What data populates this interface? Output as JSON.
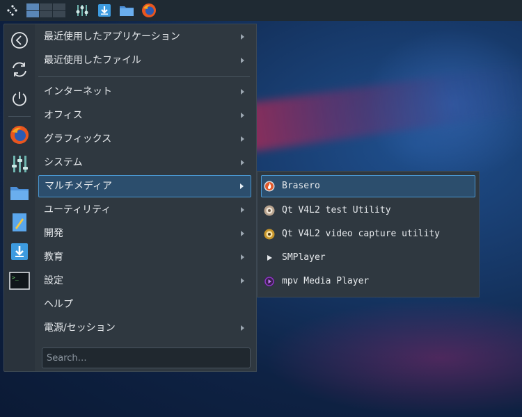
{
  "panel": {
    "icons": [
      "app-launcher-icon",
      "pager",
      "mixer-icon",
      "downloader-icon",
      "file-manager-icon",
      "firefox-icon"
    ]
  },
  "sidebar": {
    "icons": [
      "back-icon",
      "refresh-icon",
      "power-icon",
      "firefox-icon",
      "mixer-icon",
      "file-manager-icon",
      "text-editor-icon",
      "downloader-icon",
      "terminal-icon"
    ]
  },
  "menu": {
    "items": [
      {
        "label": "最近使用したアプリケーション"
      },
      {
        "label": "最近使用したファイル"
      },
      {
        "label": "インターネット"
      },
      {
        "label": "オフィス"
      },
      {
        "label": "グラフィックス"
      },
      {
        "label": "システム"
      },
      {
        "label": "マルチメディア"
      },
      {
        "label": "ユーティリティ"
      },
      {
        "label": "開発"
      },
      {
        "label": "教育"
      },
      {
        "label": "設定"
      },
      {
        "label": "ヘルプ"
      },
      {
        "label": "電源/セッション"
      }
    ],
    "selected": "マルチメディア"
  },
  "search": {
    "placeholder": "Search…"
  },
  "submenu": {
    "items": [
      {
        "label": "Brasero",
        "icon": "brasero-icon"
      },
      {
        "label": "Qt V4L2 test Utility",
        "icon": "qv4l2-icon"
      },
      {
        "label": "Qt V4L2 video capture utility",
        "icon": "qvidcap-icon"
      },
      {
        "label": "SMPlayer",
        "icon": "smplayer-icon"
      },
      {
        "label": "mpv Media Player",
        "icon": "mpv-icon"
      }
    ],
    "selected": "Brasero"
  },
  "colors": {
    "accent": "#4a96d0",
    "selection_bg": "#2c4e6d",
    "menu_bg": "#2f3840",
    "panel_bg": "#1f2a33"
  }
}
